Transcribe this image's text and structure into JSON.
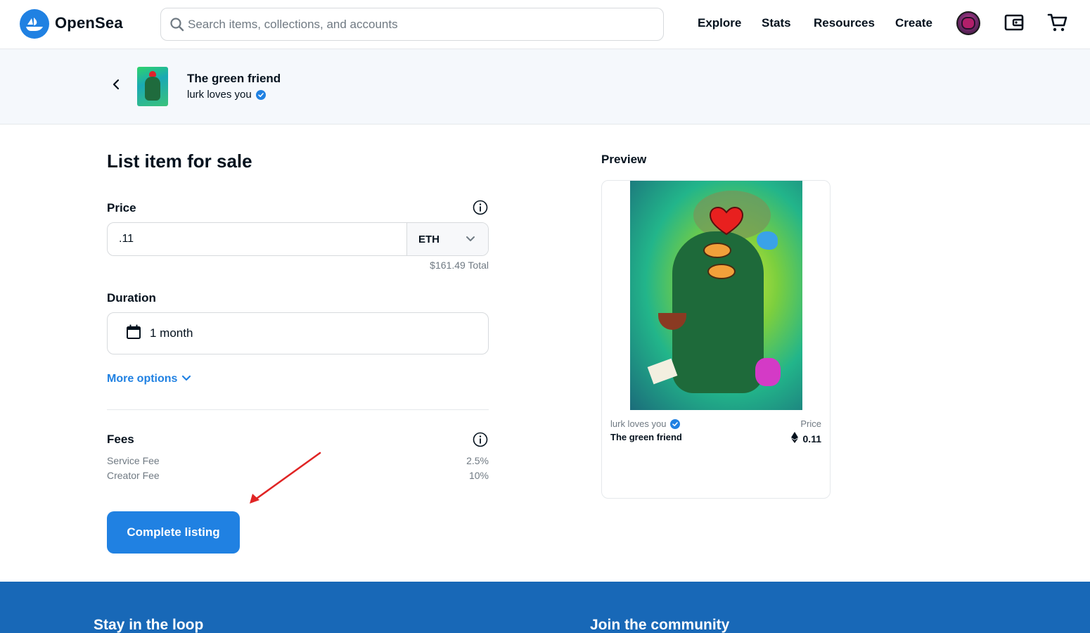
{
  "header": {
    "brand": "OpenSea",
    "search_placeholder": "Search items, collections, and accounts",
    "nav": {
      "explore": "Explore",
      "stats": "Stats",
      "resources": "Resources",
      "create": "Create"
    },
    "icons": [
      "opensea-logo-icon",
      "search-icon",
      "avatar",
      "wallet-icon",
      "cart-icon"
    ]
  },
  "item": {
    "name": "The green friend",
    "collection": "lurk loves you"
  },
  "form": {
    "title": "List item for sale",
    "price_label": "Price",
    "price_value": ".11",
    "currency": "ETH",
    "total": "$161.49 Total",
    "duration_label": "Duration",
    "duration_value": "1 month",
    "more_options": "More options",
    "fees_label": "Fees",
    "fees": [
      {
        "label": "Service Fee",
        "value": "2.5%"
      },
      {
        "label": "Creator Fee",
        "value": "10%"
      }
    ],
    "submit_label": "Complete listing"
  },
  "preview": {
    "title": "Preview",
    "collection": "lurk loves you",
    "name": "The green friend",
    "price_label": "Price",
    "price": "0.11"
  },
  "footer": {
    "left_heading": "Stay in the loop",
    "right_heading": "Join the community"
  },
  "colors": {
    "accent": "#2081e2",
    "footer_bg": "#1868b7",
    "annotation_arrow": "#e02424",
    "muted_text": "#707a83"
  }
}
